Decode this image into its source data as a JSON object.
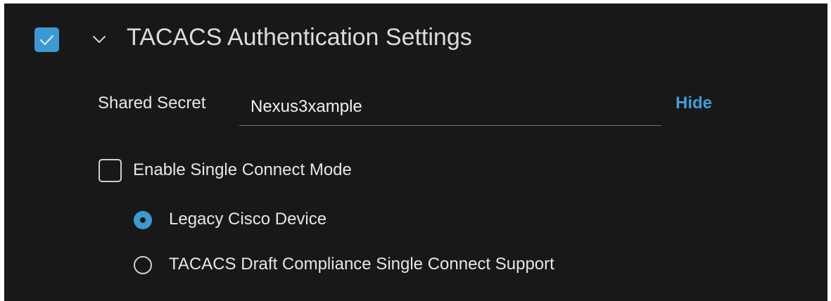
{
  "section": {
    "title": "TACACS Authentication Settings",
    "enabled": true,
    "expanded": true,
    "accent_color": "#3b9ad2"
  },
  "shared_secret": {
    "label": "Shared Secret",
    "value": "Nexus3xample",
    "toggle_label": "Hide"
  },
  "single_connect": {
    "label": "Enable Single Connect Mode",
    "checked": false
  },
  "radio_options": [
    {
      "label": "Legacy Cisco Device",
      "selected": true
    },
    {
      "label": "TACACS Draft Compliance Single Connect Support",
      "selected": false
    }
  ],
  "icons": {
    "section_checkbox": "check-icon",
    "expand": "chevron-down-icon"
  }
}
